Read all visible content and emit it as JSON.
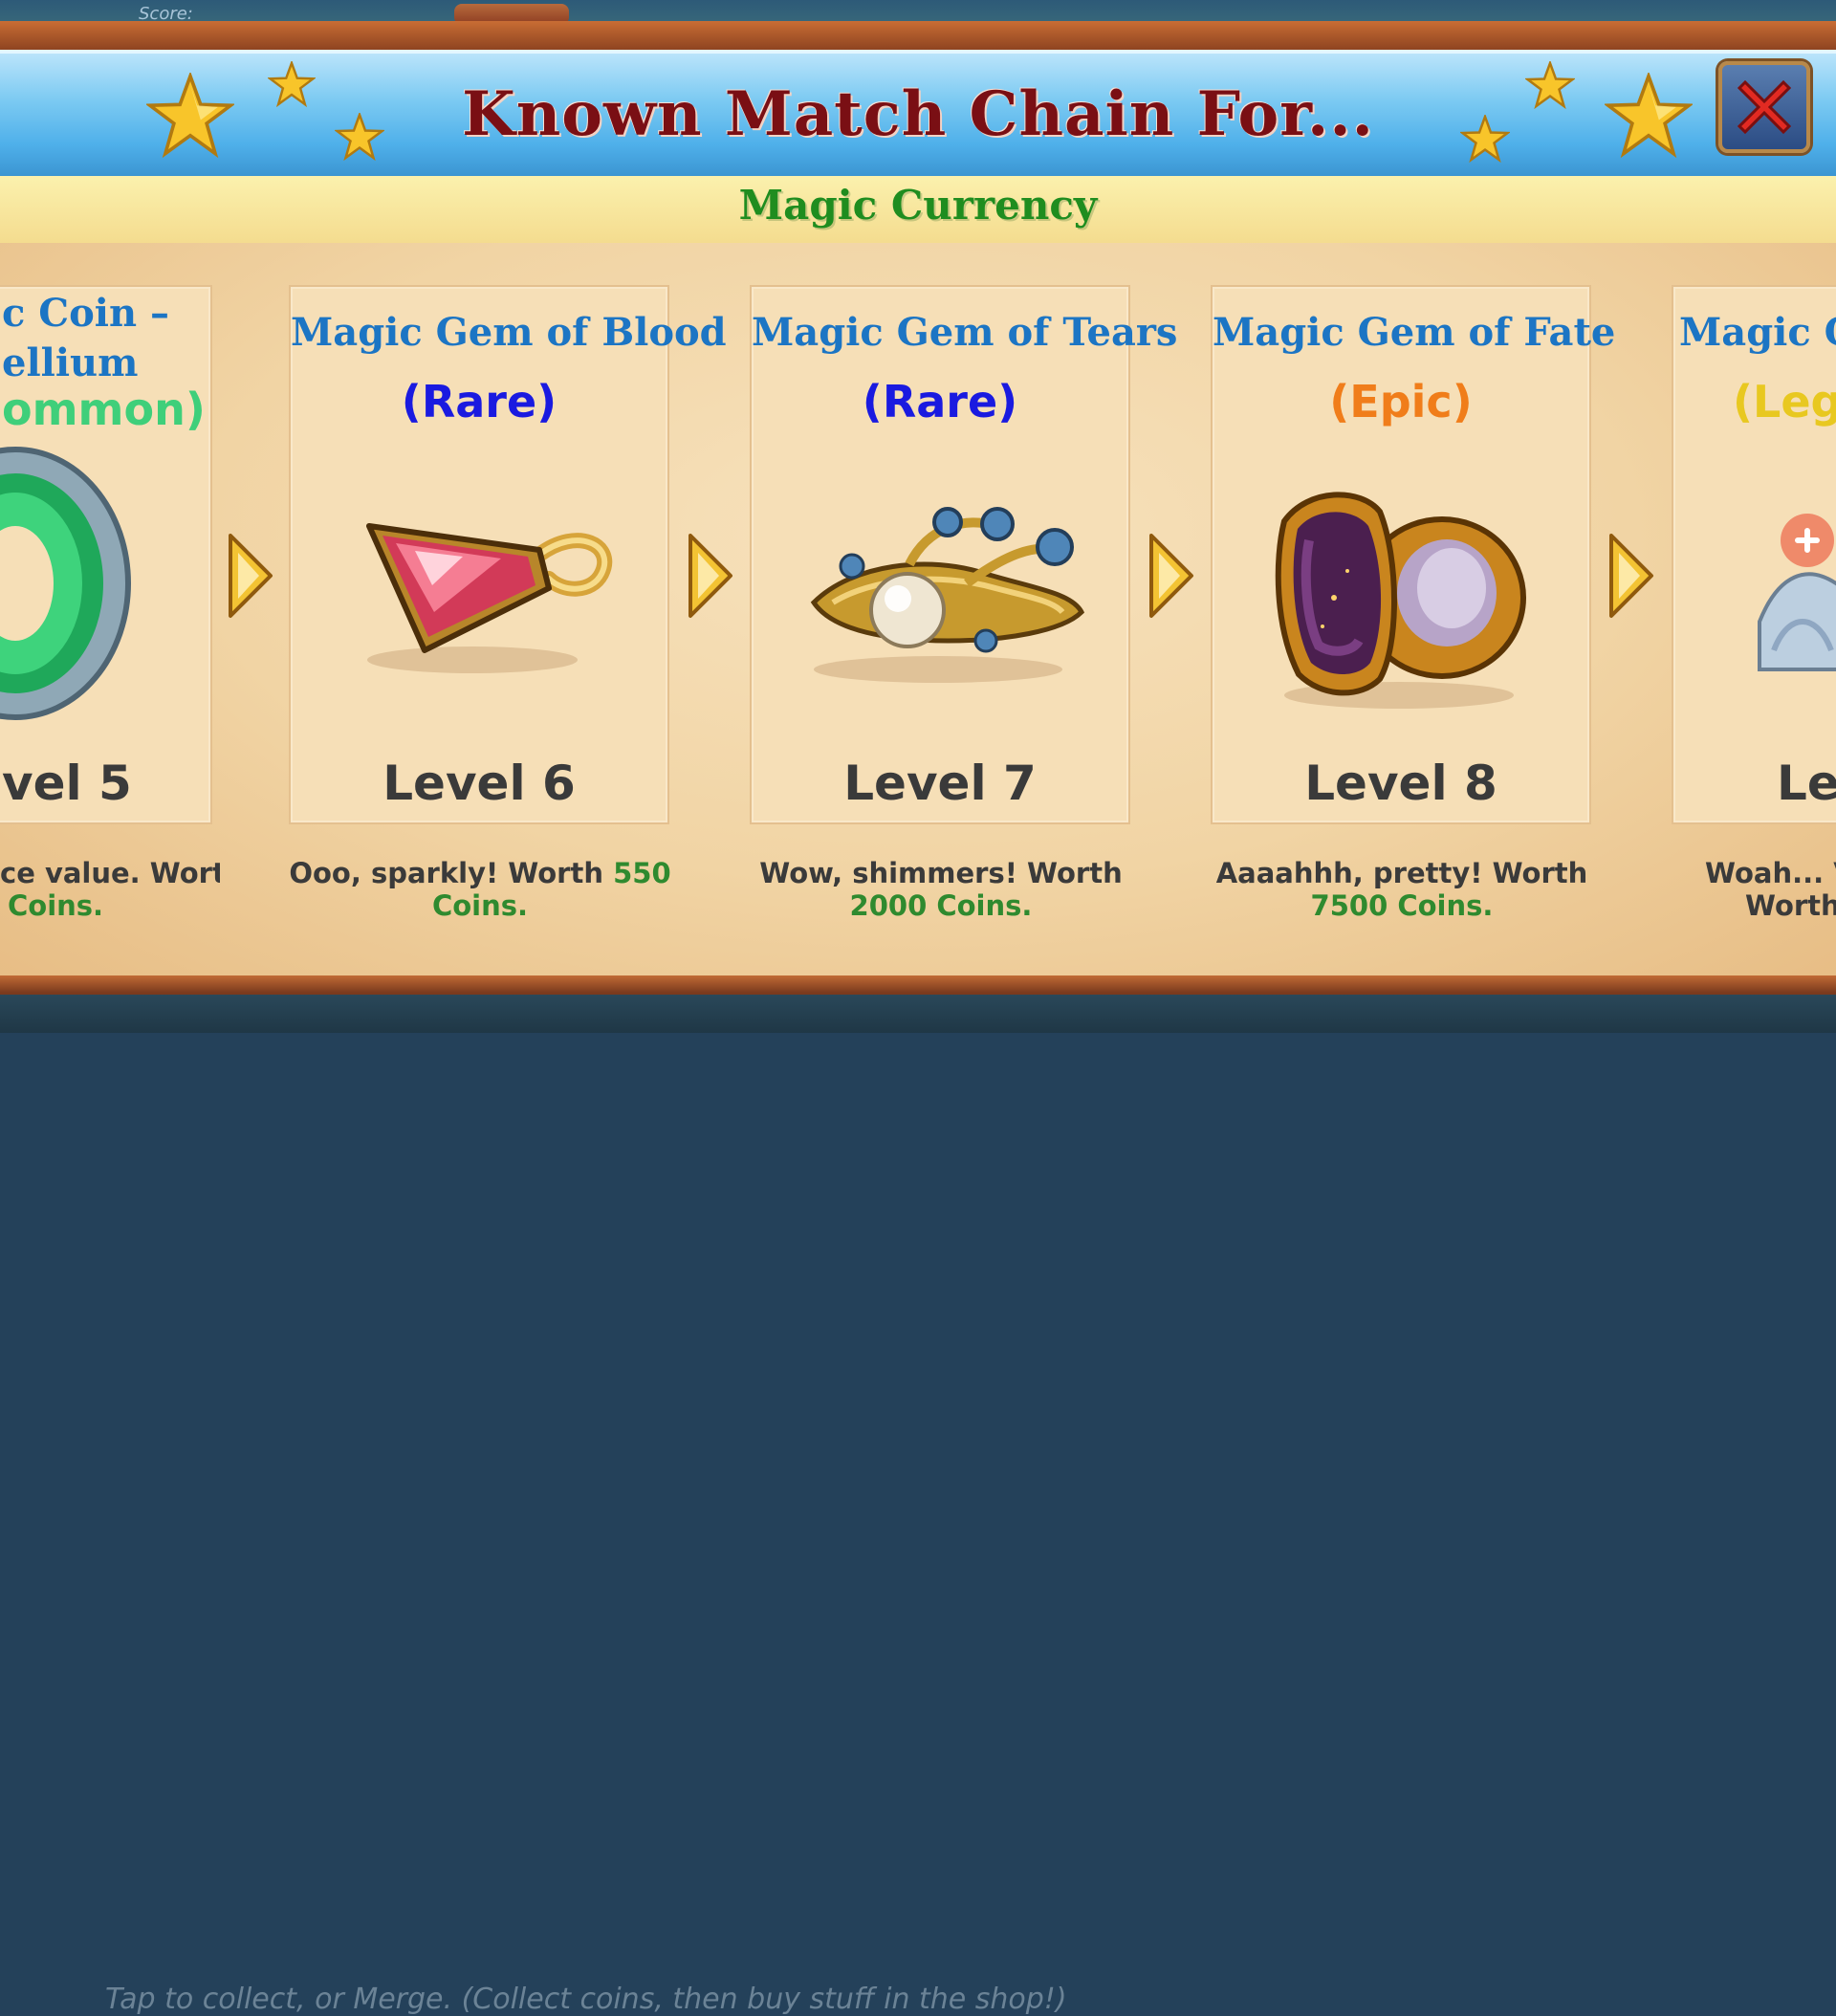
{
  "background": {
    "score_label": "Score:",
    "hint_text": "Tap to collect, or Merge. (Collect coins, then buy stuff in the shop!)"
  },
  "header": {
    "title": "Known Match Chain For...",
    "subtitle": "Magic Currency",
    "close_icon": "close-x-icon"
  },
  "colors": {
    "title": "#7a0f14",
    "subtitle": "#1f8d1f",
    "item_name": "#1c75c4",
    "rare": "#1a1ae0",
    "epic": "#f07d1a",
    "uncommon": "#3fcf7a",
    "legendary": "#e8c820",
    "coins": "#2f8a2f"
  },
  "chain": [
    {
      "name_line1": "c Coin –",
      "name_line2": "ellium",
      "rarity": "ommon)",
      "level": "vel 5",
      "desc_line1": "ce value. Worth",
      "desc_coins": "Coins.",
      "icon": "magic-coin-icon"
    },
    {
      "name": "Magic Gem of Blood",
      "rarity": "(Rare)",
      "level": "Level 6",
      "desc_text": "Ooo, sparkly! Worth ",
      "desc_coins_num": "550",
      "desc_coins": "Coins.",
      "icon": "gem-of-blood-icon"
    },
    {
      "name": "Magic Gem of Tears",
      "rarity": "(Rare)",
      "level": "Level 7",
      "desc_text": "Wow, shimmers! Worth",
      "desc_coins": "2000 Coins.",
      "icon": "gem-of-tears-icon"
    },
    {
      "name": "Magic Gem of Fate",
      "rarity": "(Epic)",
      "level": "Level 8",
      "desc_text": "Aaaahhh, pretty! Worth",
      "desc_coins": "7500 Coins.",
      "icon": "gem-of-fate-icon"
    },
    {
      "name": "Magic G",
      "rarity": "(Lege",
      "level": "Le",
      "desc_line1": "Woah... V",
      "desc_line2": "Worth",
      "icon": "tiara-icon"
    }
  ],
  "next_arrow_icon": "chevron-right-icon"
}
